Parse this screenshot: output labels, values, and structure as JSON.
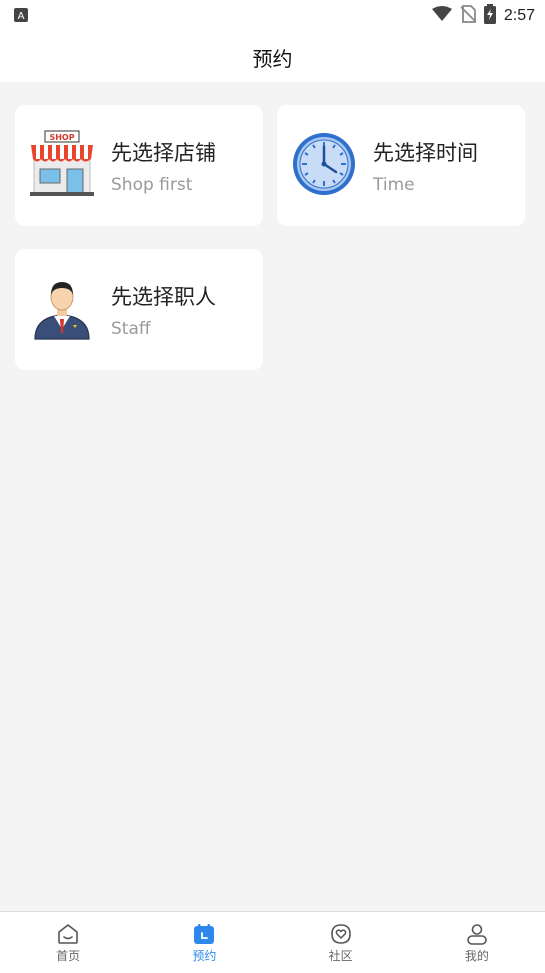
{
  "status_bar": {
    "time": "2:57",
    "notification_badge": "A"
  },
  "header": {
    "title": "预约"
  },
  "cards": [
    {
      "title": "先选择店铺",
      "subtitle": "Shop first",
      "icon": "shop-icon",
      "icon_text": "SHOP"
    },
    {
      "title": "先选择时间",
      "subtitle": "Time",
      "icon": "clock-icon"
    },
    {
      "title": "先选择职人",
      "subtitle": "Staff",
      "icon": "staff-icon"
    }
  ],
  "tabbar": {
    "active": "预约",
    "items": [
      {
        "label": "首页",
        "icon": "home-icon"
      },
      {
        "label": "预约",
        "icon": "calendar-icon"
      },
      {
        "label": "社区",
        "icon": "community-heart-icon"
      },
      {
        "label": "我的",
        "icon": "profile-icon"
      }
    ]
  },
  "colors": {
    "accent": "#2e88ec",
    "background": "#f4f4f4",
    "card": "#ffffff",
    "subtitle": "#9a9a9a"
  }
}
